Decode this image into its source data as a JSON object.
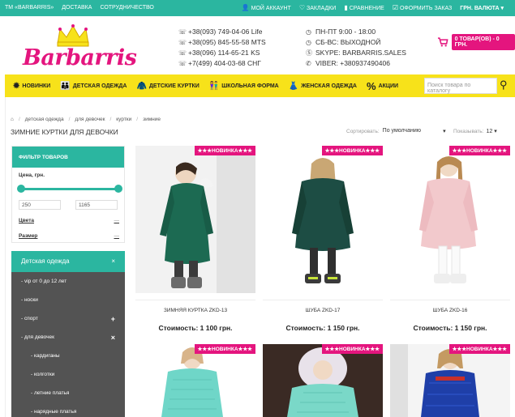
{
  "topbar": {
    "links": [
      "ТМ «BARBARRIS»",
      "ДОСТАВКА",
      "СОТРУДНИЧЕСТВО"
    ],
    "account": "МОЙ АККАУНТ",
    "bookmarks": "ЗАКЛАДКИ",
    "compare": "СРАВНЕНИЕ",
    "checkout": "ОФОРМИТЬ ЗАКАЗ",
    "currency": "ГРН. ВАЛЮТА ▾"
  },
  "header": {
    "logo_text": "Barbarris",
    "phones": [
      "+38(093) 749-04-06 Life",
      "+38(095) 845-55-58 MTS",
      "+38(096) 114-65-21 KS",
      "+7(499) 404-03-68 СНГ"
    ],
    "hours": [
      "ПН-ПТ 9:00 - 18:00",
      "СБ-ВС: ВЫХОДНОЙ",
      "SKYPE: BARBARRIS.SALES",
      "VIBER: +380937490406"
    ],
    "cart_label": "0 ТОВАР(ОВ) - 0 ГРН."
  },
  "nav": {
    "items": [
      "НОВИНКИ",
      "ДЕТСКАЯ ОДЕЖДА",
      "ДЕТСКИЕ КУРТКИ",
      "ШКОЛЬНАЯ ФОРМА",
      "ЖЕНСКАЯ ОДЕЖДА",
      "АКЦИИ"
    ],
    "search_placeholder": "Поиск товара по каталогу"
  },
  "breadcrumbs": [
    "детская одежда",
    "для девочек",
    "куртки",
    "зимние"
  ],
  "page_title": "ЗИМНИЕ КУРТКИ ДЛЯ ДЕВОЧКИ",
  "sort": {
    "label": "Сортировать:",
    "value": "По умолчанию"
  },
  "limit": {
    "label": "Показывать:",
    "value": "12"
  },
  "filter": {
    "title": "ФИЛЬТР ТОВАРОВ",
    "price_label": "Цена, грн.",
    "min": "250",
    "max": "1165",
    "color_label": "Цвета",
    "size_label": "Размер"
  },
  "categories": {
    "title": "Детская одежда",
    "items": [
      {
        "label": "- vip от 0 до 12 лет",
        "mark": ""
      },
      {
        "label": "- носки",
        "mark": ""
      },
      {
        "label": "- спорт",
        "mark": "+"
      },
      {
        "label": "- для девочек",
        "mark": "×"
      },
      {
        "label": "- кардиганы",
        "mark": "",
        "sub": true
      },
      {
        "label": "- колготки",
        "mark": "",
        "sub": true
      },
      {
        "label": "- летние платья",
        "mark": "",
        "sub": true
      },
      {
        "label": "- нарядные платья",
        "mark": "",
        "sub": true
      }
    ]
  },
  "badge": "★★★НОВИНКА★★★",
  "products": [
    {
      "name": "ЗИМНЯЯ КУРТКА ZKD-13",
      "price": "Стоимость: 1 100 грн."
    },
    {
      "name": "ШУБА ZKD-17",
      "price": "Стоимость: 1 150 грн."
    },
    {
      "name": "ШУБА ZKD-16",
      "price": "Стоимость: 1 150 грн."
    }
  ],
  "colors": {
    "teal": "#2bb6a0",
    "pink": "#e4157e",
    "yellow": "#f7e21a"
  }
}
